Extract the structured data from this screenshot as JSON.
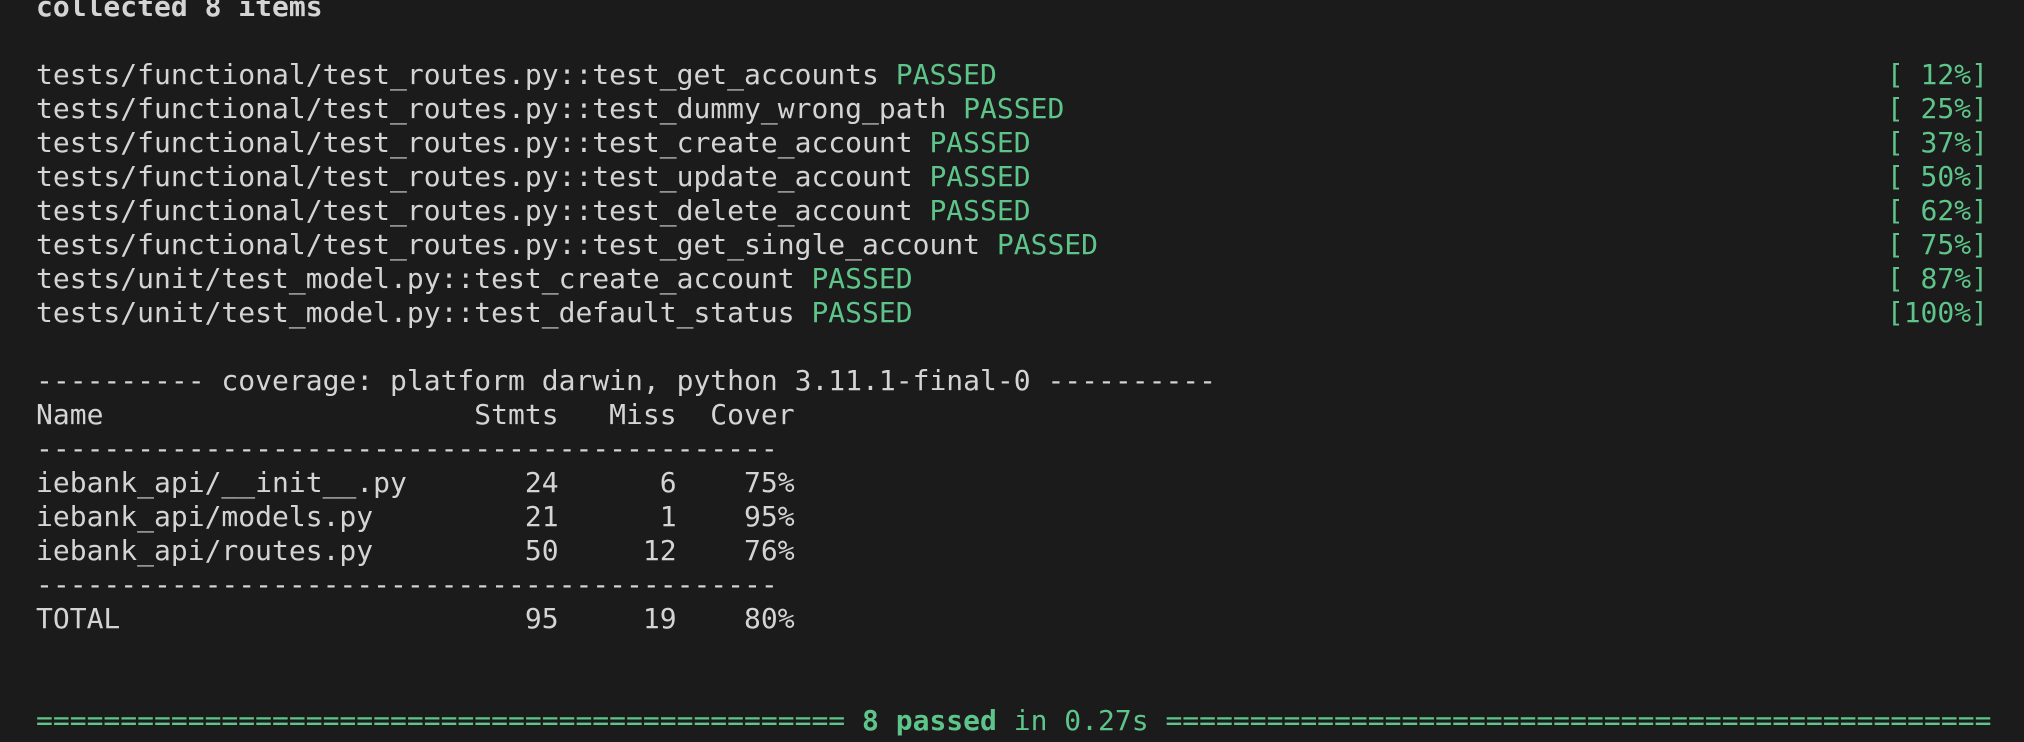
{
  "header": {
    "collected": "collected 8 items"
  },
  "tests": [
    {
      "name": "tests/functional/test_routes.py::test_get_accounts",
      "status": "PASSED",
      "progress": "[ 12%]"
    },
    {
      "name": "tests/functional/test_routes.py::test_dummy_wrong_path",
      "status": "PASSED",
      "progress": "[ 25%]"
    },
    {
      "name": "tests/functional/test_routes.py::test_create_account",
      "status": "PASSED",
      "progress": "[ 37%]"
    },
    {
      "name": "tests/functional/test_routes.py::test_update_account",
      "status": "PASSED",
      "progress": "[ 50%]"
    },
    {
      "name": "tests/functional/test_routes.py::test_delete_account",
      "status": "PASSED",
      "progress": "[ 62%]"
    },
    {
      "name": "tests/functional/test_routes.py::test_get_single_account",
      "status": "PASSED",
      "progress": "[ 75%]"
    },
    {
      "name": "tests/unit/test_model.py::test_create_account",
      "status": "PASSED",
      "progress": "[ 87%]"
    },
    {
      "name": "tests/unit/test_model.py::test_default_status",
      "status": "PASSED",
      "progress": "[100%]"
    }
  ],
  "coverage": {
    "title": "---------- coverage: platform darwin, python 3.11.1-final-0 ----------",
    "header": "Name                      Stmts   Miss  Cover",
    "separator": "--------------------------------------------",
    "rows": [
      "iebank_api/__init__.py       24      6    75%",
      "iebank_api/models.py         21      1    95%",
      "iebank_api/routes.py         50     12    76%"
    ],
    "total": "TOTAL                        95     19    80%"
  },
  "summary": {
    "left_rule": "================================================",
    "passed": "8 passed",
    "time": "in 0.27s",
    "right_rule": "================================================="
  },
  "colors": {
    "background": "#1b1b1b",
    "text": "#d4d4d4",
    "green": "#5ec58a"
  }
}
